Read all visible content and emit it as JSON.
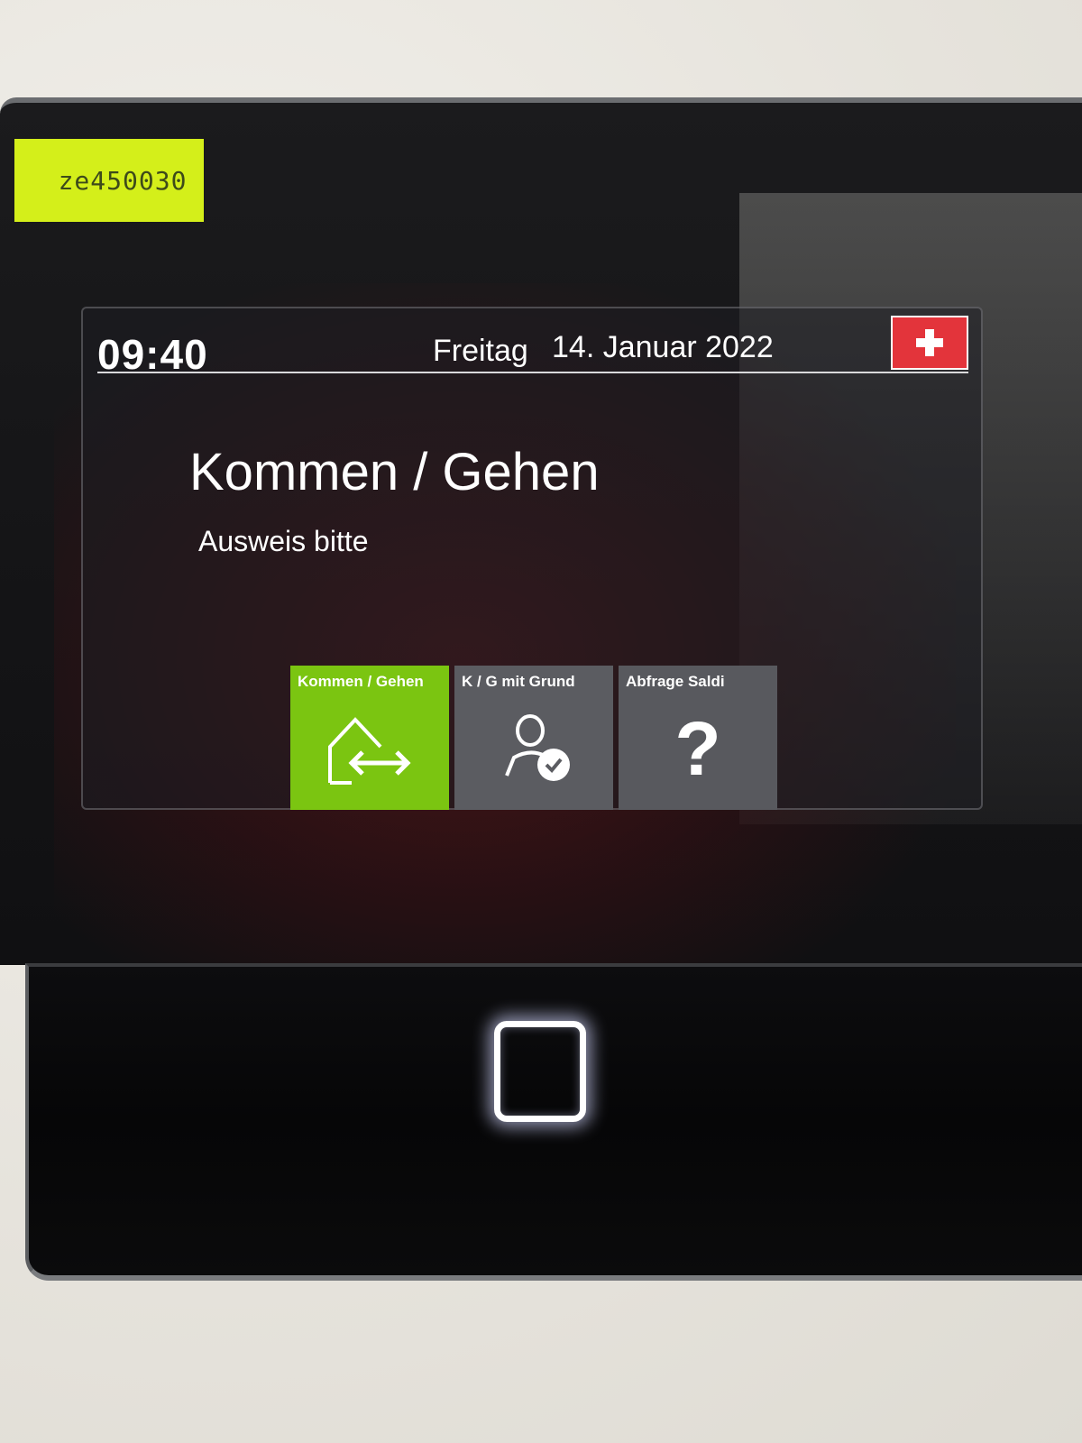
{
  "device_label": "ze450030",
  "status_bar": {
    "time": "09:40",
    "weekday": "Freitag",
    "date": "14. Januar 2022",
    "flag_icon": "swiss-flag-icon"
  },
  "main": {
    "title": "Kommen / Gehen",
    "subtitle": "Ausweis bitte"
  },
  "tiles": [
    {
      "label": "Kommen / Gehen",
      "icon": "house-arrows-icon",
      "color": "#7bc511"
    },
    {
      "label": "K / G mit Grund",
      "icon": "user-check-icon",
      "color": "#5b5c61"
    },
    {
      "label": "Abfrage Saldi",
      "icon": "question-icon",
      "glyph": "?",
      "color": "#58595e"
    }
  ]
}
